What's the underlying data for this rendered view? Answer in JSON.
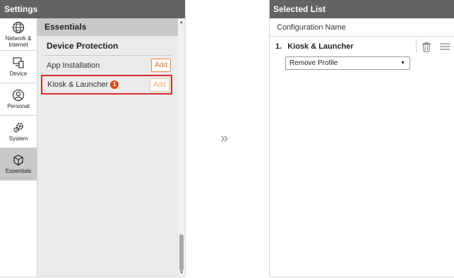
{
  "left": {
    "title": "Settings",
    "nav": [
      {
        "label": "Network & Internet",
        "icon": "globe-icon"
      },
      {
        "label": "Device",
        "icon": "device-icon"
      },
      {
        "label": "Personal",
        "icon": "person-icon"
      },
      {
        "label": "System",
        "icon": "gears-icon"
      },
      {
        "label": "Essentials",
        "icon": "cube-icon"
      }
    ],
    "section_title": "Essentials",
    "subsection_title": "Device Protection",
    "items": [
      {
        "label": "App Installation",
        "button": "Add"
      },
      {
        "label": "Kiosk & Launcher",
        "badge": "1",
        "button": "Add"
      }
    ]
  },
  "transfer_icon": "»",
  "right": {
    "title": "Selected List",
    "column_header": "Configuration Name",
    "entries": [
      {
        "number": "1.",
        "name": "Kiosk & Launcher",
        "selected_option": "Remove Profile"
      }
    ]
  },
  "colors": {
    "header_bg": "#636363",
    "accent": "#e36c16",
    "highlight_border": "#d62b2b",
    "badge": "#d5501c"
  }
}
